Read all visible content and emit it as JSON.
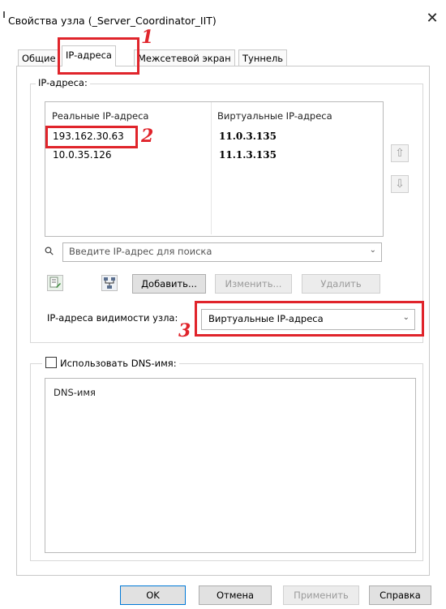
{
  "window": {
    "title": "Свойства узла (_Server_Coordinator_IIT)",
    "close_glyph": "✕"
  },
  "tabs": [
    {
      "label": "Общие"
    },
    {
      "label": "IP-адреса",
      "active": true
    },
    {
      "label": "Межсетевой экран"
    },
    {
      "label": "Туннель"
    }
  ],
  "ip_group": {
    "legend": "IP-адреса:",
    "col_real": "Реальные IP-адреса",
    "col_virtual": "Виртуальные IP-адреса",
    "rows": [
      {
        "real": "193.162.30.63",
        "virtual": "11.0.3.135"
      },
      {
        "real": "10.0.35.126",
        "virtual": "11.1.3.135"
      }
    ],
    "up_icon": "⇧",
    "down_icon": "⇩"
  },
  "search": {
    "placeholder": "Введите IP-адрес для поиска",
    "icon": "⚲",
    "chevron": "⌄"
  },
  "actions": {
    "add": "Добавить...",
    "edit": "Изменить...",
    "delete": "Удалить"
  },
  "visibility": {
    "label": "IP-адреса видимости узла:",
    "value": "Виртуальные IP-адреса",
    "chevron": "⌄"
  },
  "dns": {
    "checkbox_label": "Использовать DNS-имя:",
    "checked": false,
    "col_header": "DNS-имя"
  },
  "annotations": {
    "n1": "1",
    "n2": "2",
    "n3": "3"
  },
  "footer": {
    "ok": "OK",
    "cancel": "Отмена",
    "apply": "Применить",
    "help": "Справка"
  },
  "colors": {
    "highlight_red": "#e0242b"
  }
}
